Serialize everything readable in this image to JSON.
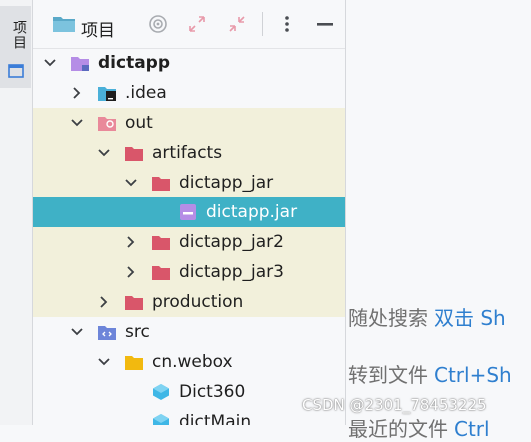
{
  "sidebar": {
    "tab_label": "项目"
  },
  "panel": {
    "title": "项目",
    "tree": [
      {
        "label": "dictapp",
        "icon": "module-folder-icon",
        "expanded": true,
        "bold": true
      },
      {
        "label": ".idea",
        "icon": "idea-folder-icon",
        "expanded": false
      },
      {
        "label": "out",
        "icon": "excluded-folder-icon",
        "expanded": true
      },
      {
        "label": "artifacts",
        "icon": "folder-red-icon",
        "expanded": true
      },
      {
        "label": "dictapp_jar",
        "icon": "folder-red-icon",
        "expanded": true
      },
      {
        "label": "dictapp.jar",
        "icon": "jar-file-icon",
        "selected": true
      },
      {
        "label": "dictapp_jar2",
        "icon": "folder-red-icon",
        "expanded": false
      },
      {
        "label": "dictapp_jar3",
        "icon": "folder-red-icon",
        "expanded": false
      },
      {
        "label": "production",
        "icon": "folder-red-icon",
        "expanded": false
      },
      {
        "label": "src",
        "icon": "source-folder-icon",
        "expanded": true
      },
      {
        "label": "cn.webox",
        "icon": "package-folder-icon",
        "expanded": true
      },
      {
        "label": "Dict360",
        "icon": "class-file-icon"
      },
      {
        "label": "dictMain",
        "icon": "class-file-icon"
      }
    ]
  },
  "editor": {
    "hints": [
      {
        "text": "随处搜索",
        "key": "双击 Sh"
      },
      {
        "text": "转到文件",
        "key": "Ctrl+Sh"
      },
      {
        "text": "最近的文件",
        "key": "Ctrl"
      }
    ]
  },
  "watermark": "CSDN @2301_78453225",
  "colors": {
    "selection": "#3fb1c6",
    "excluded_highlight": "#f2f0db",
    "excluded_folder": "#d9566a",
    "shortcut_key": "#2f7fcf"
  }
}
